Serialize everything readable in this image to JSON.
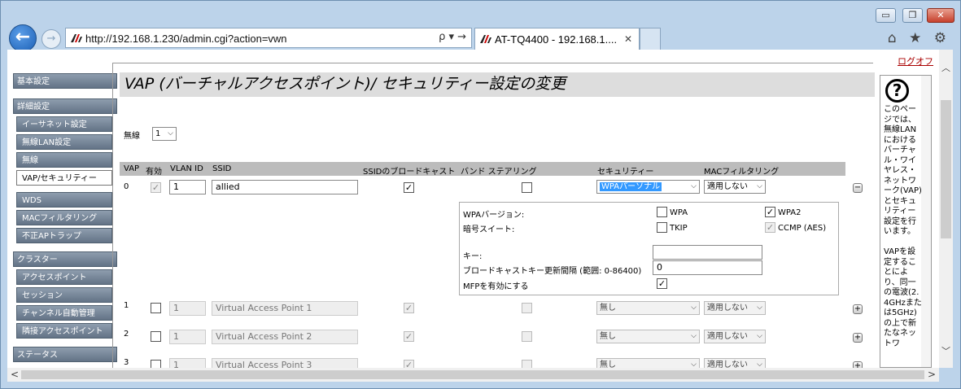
{
  "browser": {
    "url": "http://192.168.1.230/admin.cgi?action=vwn",
    "tab_title": "AT-TQ4400 - 192.168.1....",
    "search_arrow": "ρ ▾ →",
    "min": "▭",
    "max": "❐",
    "close": "✕",
    "back": "←",
    "forward": "→",
    "tab_close": "✕",
    "tools": "⌂ ★ ⚙"
  },
  "logout": "ログオフ",
  "sidebar": {
    "groups": [
      {
        "label": "基本設定",
        "items": []
      },
      {
        "label": "詳細設定",
        "items": [
          "イーサネット設定",
          "無線LAN設定",
          "無線",
          "VAP/セキュリティー",
          "WDS",
          "MACフィルタリング",
          "不正APトラップ"
        ]
      },
      {
        "label": "クラスター",
        "items": [
          "アクセスポイント",
          "セッション",
          "チャンネル自動管理",
          "隣接アクセスポイント"
        ]
      },
      {
        "label": "ステータス",
        "items": []
      }
    ],
    "active": "VAP/セキュリティー"
  },
  "page_title": "VAP (バーチャルアクセスポイント)/ セキュリティー設定の変更",
  "radio": {
    "label": "無線",
    "value": "1"
  },
  "table": {
    "headers": [
      "VAP",
      "有効",
      "VLAN ID",
      "SSID",
      "SSIDのブロードキャスト",
      "バンド ステアリング",
      "セキュリティー",
      "MACフィルタリング"
    ],
    "rows": [
      {
        "vap": "0",
        "enabled": true,
        "vlan": "1",
        "ssid": "allied",
        "broadcast": true,
        "band_steering": false,
        "security": "WPAパーソナル",
        "mac": "適用しない",
        "toggle": "−"
      },
      {
        "vap": "1",
        "enabled": false,
        "vlan": "1",
        "ssid": "Virtual Access Point 1",
        "broadcast": true,
        "band_steering": false,
        "security": "無し",
        "mac": "適用しない",
        "toggle": "+"
      },
      {
        "vap": "2",
        "enabled": false,
        "vlan": "1",
        "ssid": "Virtual Access Point 2",
        "broadcast": true,
        "band_steering": false,
        "security": "無し",
        "mac": "適用しない",
        "toggle": "+"
      },
      {
        "vap": "3",
        "enabled": false,
        "vlan": "1",
        "ssid": "Virtual Access Point 3",
        "broadcast": true,
        "band_steering": false,
        "security": "無し",
        "mac": "適用しない",
        "toggle": "+"
      }
    ]
  },
  "wpa": {
    "version_label": "WPAバージョン:",
    "wpa_label": "WPA",
    "wpa2_label": "WPA2",
    "cipher_label": "暗号スイート:",
    "tkip_label": "TKIP",
    "ccmp_label": "CCMP (AES)",
    "key_label": "キー:",
    "key_value": "",
    "rekey_label": "ブロードキャストキー更新間隔 (範囲: 0-86400)",
    "rekey_value": "0",
    "mfp_label": "MFPを有効にする"
  },
  "help": {
    "icon": "?",
    "text": "このページでは、無線LANにおけるバーチャル・ワイヤレス・ネットワーク(VAP)とセキュリティー設定を行います。\n\nVAPを設定することにより、同一の電波(2.4GHzまたは5GHz)の上で新たなネットワ"
  }
}
